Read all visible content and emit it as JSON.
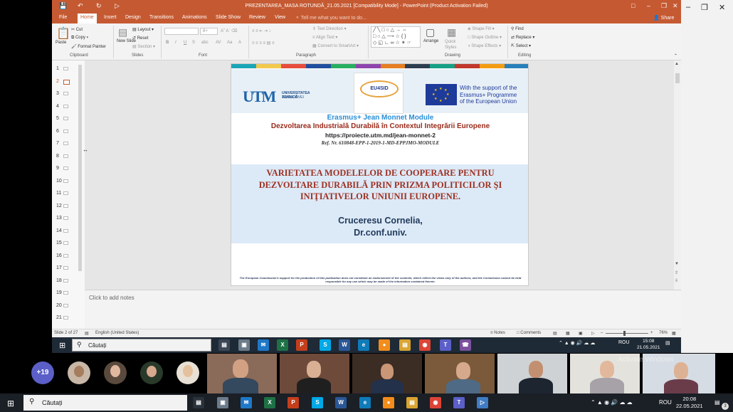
{
  "titlebar": {
    "title": "PREZENTAREA_MASA ROTUNDĂ_21.05.2021 [Compatibility Mode] - PowerPoint (Product Activation Failed)"
  },
  "tabs": [
    "File",
    "Home",
    "Insert",
    "Design",
    "Transitions",
    "Animations",
    "Slide Show",
    "Review",
    "View"
  ],
  "tell_me": "Tell me what you want to do...",
  "share": "Share",
  "ribbon": {
    "clipboard": {
      "paste": "Paste",
      "cut": "Cut",
      "copy": "Copy",
      "format_painter": "Format Painter",
      "group": "Clipboard"
    },
    "slides": {
      "new_slide": "New Slide",
      "layout": "Layout",
      "reset": "Reset",
      "section": "Section",
      "group": "Slides"
    },
    "font": {
      "group": "Font",
      "size": "8+"
    },
    "paragraph": {
      "text_direction": "Text Direction",
      "align_text": "Align Text",
      "convert": "Convert to SmartArt",
      "group": "Paragraph"
    },
    "drawing": {
      "arrange": "Arrange",
      "quick_styles": "Quick Styles",
      "shape_fill": "Shape Fill",
      "shape_outline": "Shape Outline",
      "shape_effects": "Shape Effects",
      "group": "Drawing"
    },
    "editing": {
      "find": "Find",
      "replace": "Replace",
      "select": "Select",
      "group": "Editing"
    }
  },
  "thumbnails": [
    "1",
    "2",
    "3",
    "4",
    "5",
    "6",
    "7",
    "8",
    "9",
    "10",
    "11",
    "12",
    "13",
    "14",
    "15",
    "16",
    "17",
    "18",
    "19",
    "20",
    "21"
  ],
  "active_thumbnail": "2",
  "slide": {
    "stripe_colors": [
      "#1aa6b7",
      "#f2c94c",
      "#e74c3c",
      "#1f4e9c",
      "#27ae60",
      "#8e44ad",
      "#e67e22",
      "#2c3e50",
      "#16a085",
      "#c0392b",
      "#f39c12",
      "#2980b9"
    ],
    "utm_logo_mark": "UTM",
    "utm_text1": "UNIVERSITATEA TEHNICĂ",
    "utm_text2": "A MOLDOVEI",
    "eu4sid": "EU4SID",
    "eu_support": [
      "With the support of the",
      "Erasmus+ Programme",
      "of the European Union"
    ],
    "module_title": "Erasmus+ Jean Monnet Module",
    "module_subtitle": "Dezvoltarea Industrială Durabilă în Contextul Integrării Europene",
    "url": "https://proiecte.utm.md/jean-monnet-2",
    "ref": "Ref. Nr. 610848-EPP-1-2019-1-MD-EPPJMO-MODULE",
    "main_title": "VARIETATEA MODELELOR DE COOPERARE PENTRU DEZVOLTARE DURABILĂ PRIN PRIZMA POLITICILOR ŞI INIŢIATIVELOR UNIUNII EUROPENE.",
    "author_name": "Cruceresu Cornelia,",
    "author_title": "Dr.conf.univ.",
    "disclaimer": "The European Commission's support for the production of this publication does not constitute an endorsement of the contents, which reflect the views only of the authors, and the Commission cannot be held responsible for any use which may be made of the information contained therein."
  },
  "notes_placeholder": "Click to add notes",
  "statusbar": {
    "slide_count": "Slide 2 of 27",
    "language": "English (United States)",
    "notes": "Notes",
    "comments": "Comments",
    "zoom": "76%"
  },
  "remote_taskbar": {
    "search": "Căutați",
    "tray_lang": "ROU",
    "time": "15:08",
    "date": "21.05.2021"
  },
  "meeting": {
    "more_participants": "+19"
  },
  "os_taskbar": {
    "search": "Căutați",
    "tray_lang": "ROU",
    "time": "20:08",
    "date": "22.05.2021",
    "notifications": "3"
  },
  "watermark": "Activate Windows"
}
